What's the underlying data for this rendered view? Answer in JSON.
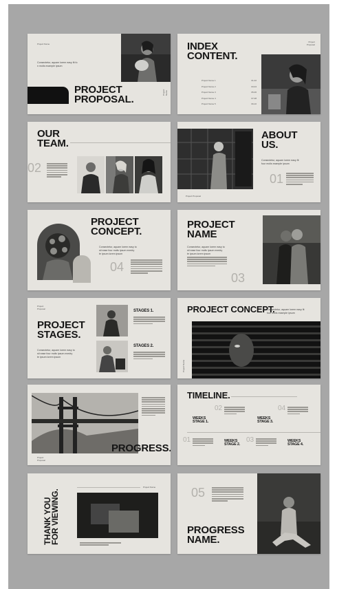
{
  "slides": {
    "proposal": {
      "small_label": "Project Name",
      "intro": "Consectetur, aquam lorem easy fit fo\nn molis example ipsum",
      "title": "PROJECT\nPROPOSAL.",
      "side": "Project Name"
    },
    "index": {
      "title": "INDEX\nCONTENT.",
      "label": "Project\nProposal",
      "items": [
        {
          "name": "Project Name 1",
          "page": "01-02"
        },
        {
          "name": "Project Name 2",
          "page": "03-04"
        },
        {
          "name": "Project Name 3",
          "page": "05-06"
        },
        {
          "name": "Project Name 4",
          "page": "07-08"
        },
        {
          "name": "Project Name 5",
          "page": "09-10"
        }
      ]
    },
    "team": {
      "title": "OUR\nTEAM.",
      "number": "02"
    },
    "about": {
      "title": "ABOUT\nUS.",
      "intro": "Consectetur, aquam lorem easy fit\nfour molis example ipsum",
      "number": "01",
      "label": "Project Proposal"
    },
    "concept": {
      "title": "PROJECT\nCONCEPT.",
      "intro": "Consectetur, aquam lorem easy to\nsit ease four molis ipsum exedry\nte ipsum lorem ipsum",
      "number": "04"
    },
    "name": {
      "title": "PROJECT\nNAME",
      "intro": "Consectetur, aquam lorem easy to\nsit ease four molis ipsum exedry\nte ipsum lorem ipsum",
      "number": "03"
    },
    "stages": {
      "label": "Project\nProposal",
      "title": "PROJECT\nSTAGES.",
      "intro": "Consectetur, aquam lorem easy to\nsit ease four molis ipsum exedry\nte ipsum lorem ipsum",
      "stage1": "Stages 1.",
      "stage2": "Stages 2."
    },
    "concept2": {
      "title": "PROJECT CONCEPT.",
      "intro": "Consectetur, aquam lorem easy fit\nfour molis example ipsum",
      "label": "Project Name"
    },
    "progress": {
      "title": "PROGRESS.",
      "label": "Project\nProposal"
    },
    "timeline": {
      "title": "TIMELINE.",
      "items": [
        {
          "num": "01",
          "label": "Weeks\nStage 1."
        },
        {
          "num": "02",
          "label": "Weeks\nStage 2."
        },
        {
          "num": "03",
          "label": "Weeks\nStage 3."
        },
        {
          "num": "04",
          "label": "Weeks\nStage 4."
        }
      ]
    },
    "thanks": {
      "title": "THANK YOU\nFOR VIEWING.",
      "label": "Project Name"
    },
    "progress_name": {
      "number": "05",
      "title": "PROGRESS\nNAME."
    }
  }
}
